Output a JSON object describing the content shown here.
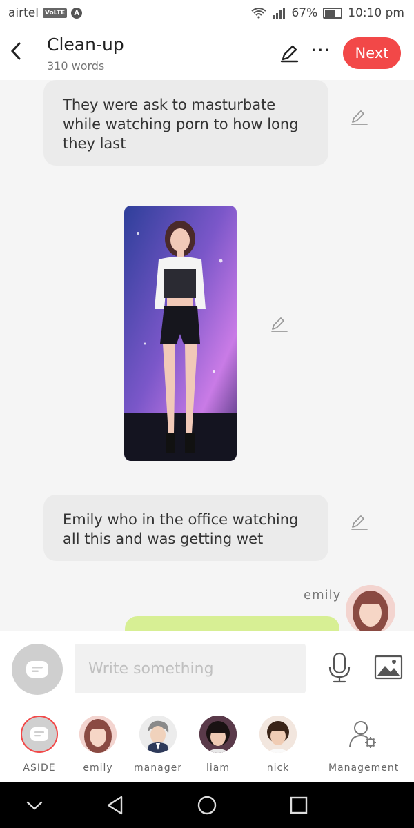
{
  "status": {
    "carrier": "airtel",
    "volte": "VoLTE",
    "network_badge": "A",
    "battery": "67%",
    "time": "10:10 pm"
  },
  "header": {
    "title": "Clean-up",
    "word_count": "310 words",
    "next_label": "Next"
  },
  "messages": [
    {
      "text": "They  were ask to masturbate while watching porn  to how long they last"
    },
    {
      "text": "Emily who in the office watching all this and was getting wet"
    }
  ],
  "sender": {
    "name": "emily"
  },
  "composer": {
    "placeholder": "Write something"
  },
  "characters": [
    {
      "name": "ASIDE"
    },
    {
      "name": "emily"
    },
    {
      "name": "manager"
    },
    {
      "name": "liam"
    },
    {
      "name": "nick"
    },
    {
      "name": "Management"
    }
  ],
  "colors": {
    "accent": "#f24848",
    "bubble": "#ebebeb",
    "green_bubble": "#d7ef94",
    "background": "#f5f5f5"
  },
  "icons": [
    "back-icon",
    "pen-icon",
    "more-icon",
    "mic-icon",
    "image-icon",
    "manage-user-icon",
    "nav-down-icon",
    "nav-back-icon",
    "nav-home-icon",
    "nav-recents-icon"
  ]
}
